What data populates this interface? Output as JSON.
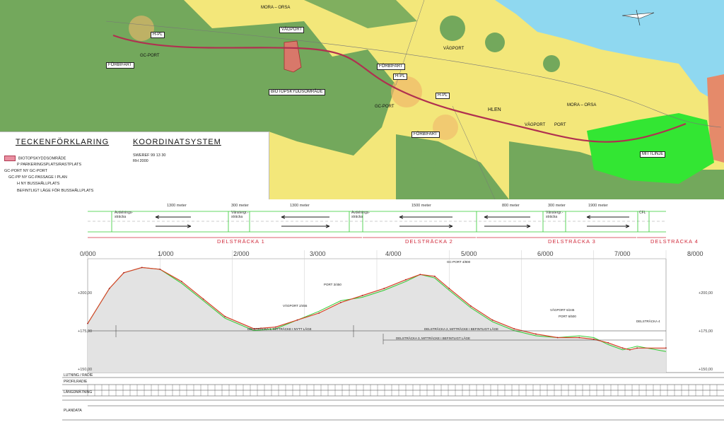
{
  "map": {
    "road_labels": [
      "MORA – ORSA",
      "MORA – ORSA"
    ],
    "legend_title": "TECKENFÖRKLARING",
    "coord_title": "KOORDINATSYSTEM",
    "coord_lines": [
      "SWEREF 99 13 30",
      "RH 2000"
    ],
    "legend_items": [
      "BIOTOPSKYDDSOMRÅDE",
      "P   PARKERINGSPLATS/RASTPLATS",
      "GC-PORT   NY GC-PORT",
      "GC-PP   NY GC-PASSAGE I PLAN",
      "H   NY BUSSHÅLLPLATS",
      "BEFINTLIGT LÄGE FÖR BUSSHÅLLPLATS"
    ],
    "labels": {
      "vp1": "VÄGPORT",
      "vp2": "VÄGPORT",
      "vp3": "VÄGPORT",
      "gc1": "GC-PORT",
      "gc2": "GC-PORT",
      "hpl1": "H-PL",
      "hpl2": "H-PL",
      "hpl3": "H-PL",
      "biotop": "BIOTOPSKYDDSOMRÅDE",
      "port": "PORT",
      "hlen": "HLEN",
      "f1": "FÖRBIFART",
      "f2": "FÖRBIFART",
      "f3": "FÖRBIFART",
      "mittlinje": "MITTLINJE"
    },
    "colors": {
      "agri": "#f3e77a",
      "forest": "#73a85c",
      "water": "#8fd8f0",
      "urban": "#f0b86a",
      "green": "#33e633",
      "road": "#b03050",
      "biotop": "#d8786a"
    }
  },
  "profile": {
    "km_labels": [
      "0/000",
      "1/000",
      "2/000",
      "3/000",
      "4/000",
      "5/000",
      "6/000",
      "7/000",
      "8/000"
    ],
    "elev_labels": [
      "+200,00",
      "+175,00",
      "+150,00"
    ],
    "delstracka": [
      "DELSTRÄCKA 1",
      "DELSTRÄCKA 2",
      "DELSTRÄCKA 3",
      "DELSTRÄCKA 4"
    ],
    "distances": [
      "1300 meter",
      "300 meter",
      "1300 meter",
      "1500 meter",
      "800 meter",
      "300 meter",
      "1900 meter"
    ],
    "section_labels": [
      "Avdelnings-\nsträcka",
      "Vänstergr.-\nsträcka",
      "Avdelnings-\nsträcka",
      "Vänstergr.-\nsträcka",
      "CFL"
    ],
    "notes": {
      "gcport": "GC-PORT 4/800",
      "port": "PORT 3/450",
      "vagport1": "VÄGPORT 2/455",
      "vagport2": "VÄGPORT 6/245",
      "port2": "PORT 6/500",
      "a1": "DELSTRÄCKA 1, MITTRÄCKE I NYTT LÄGE",
      "a2": "DELSTRÄCKA 2, MITTRÄCKE I BEFINTLIGT LÄGE",
      "a3": "DELSTRÄCKA 3, MITTRÄCKE I BEFINTLIGT LÄGE",
      "a4": "DELSTRÄCKA 4"
    },
    "row_labels": [
      "LUTNING / RADIE",
      "PROFILRADIE",
      "LÄNGDMÄTNING",
      "PLANDATA"
    ],
    "chart_data": {
      "type": "line",
      "xlabel": "",
      "ylabel": "",
      "ylim": [
        150,
        215
      ],
      "x": [
        0,
        0.3,
        0.5,
        0.75,
        1.0,
        1.3,
        1.6,
        1.9,
        2.3,
        2.6,
        2.9,
        3.2,
        3.5,
        3.8,
        4.1,
        4.4,
        4.6,
        4.8,
        5.0,
        5.3,
        5.6,
        5.9,
        6.2,
        6.5,
        6.8,
        7.0,
        7.2,
        7.4,
        7.5,
        7.6,
        8.0
      ],
      "series": [
        {
          "values": [
            178,
            198,
            207,
            210,
            209,
            202,
            192,
            182,
            175,
            176,
            180,
            184,
            190,
            194,
            198,
            203,
            206,
            205,
            198,
            188,
            180,
            175,
            172,
            170,
            170,
            169,
            167,
            164,
            163,
            164,
            164
          ]
        },
        {
          "values": [
            178,
            198,
            207,
            210,
            209,
            201,
            191,
            181,
            174,
            175,
            180,
            185,
            191,
            193,
            197,
            202,
            206,
            204,
            197,
            187,
            179,
            174,
            171,
            170,
            171,
            170,
            166,
            163,
            164,
            165,
            162
          ]
        }
      ]
    }
  }
}
